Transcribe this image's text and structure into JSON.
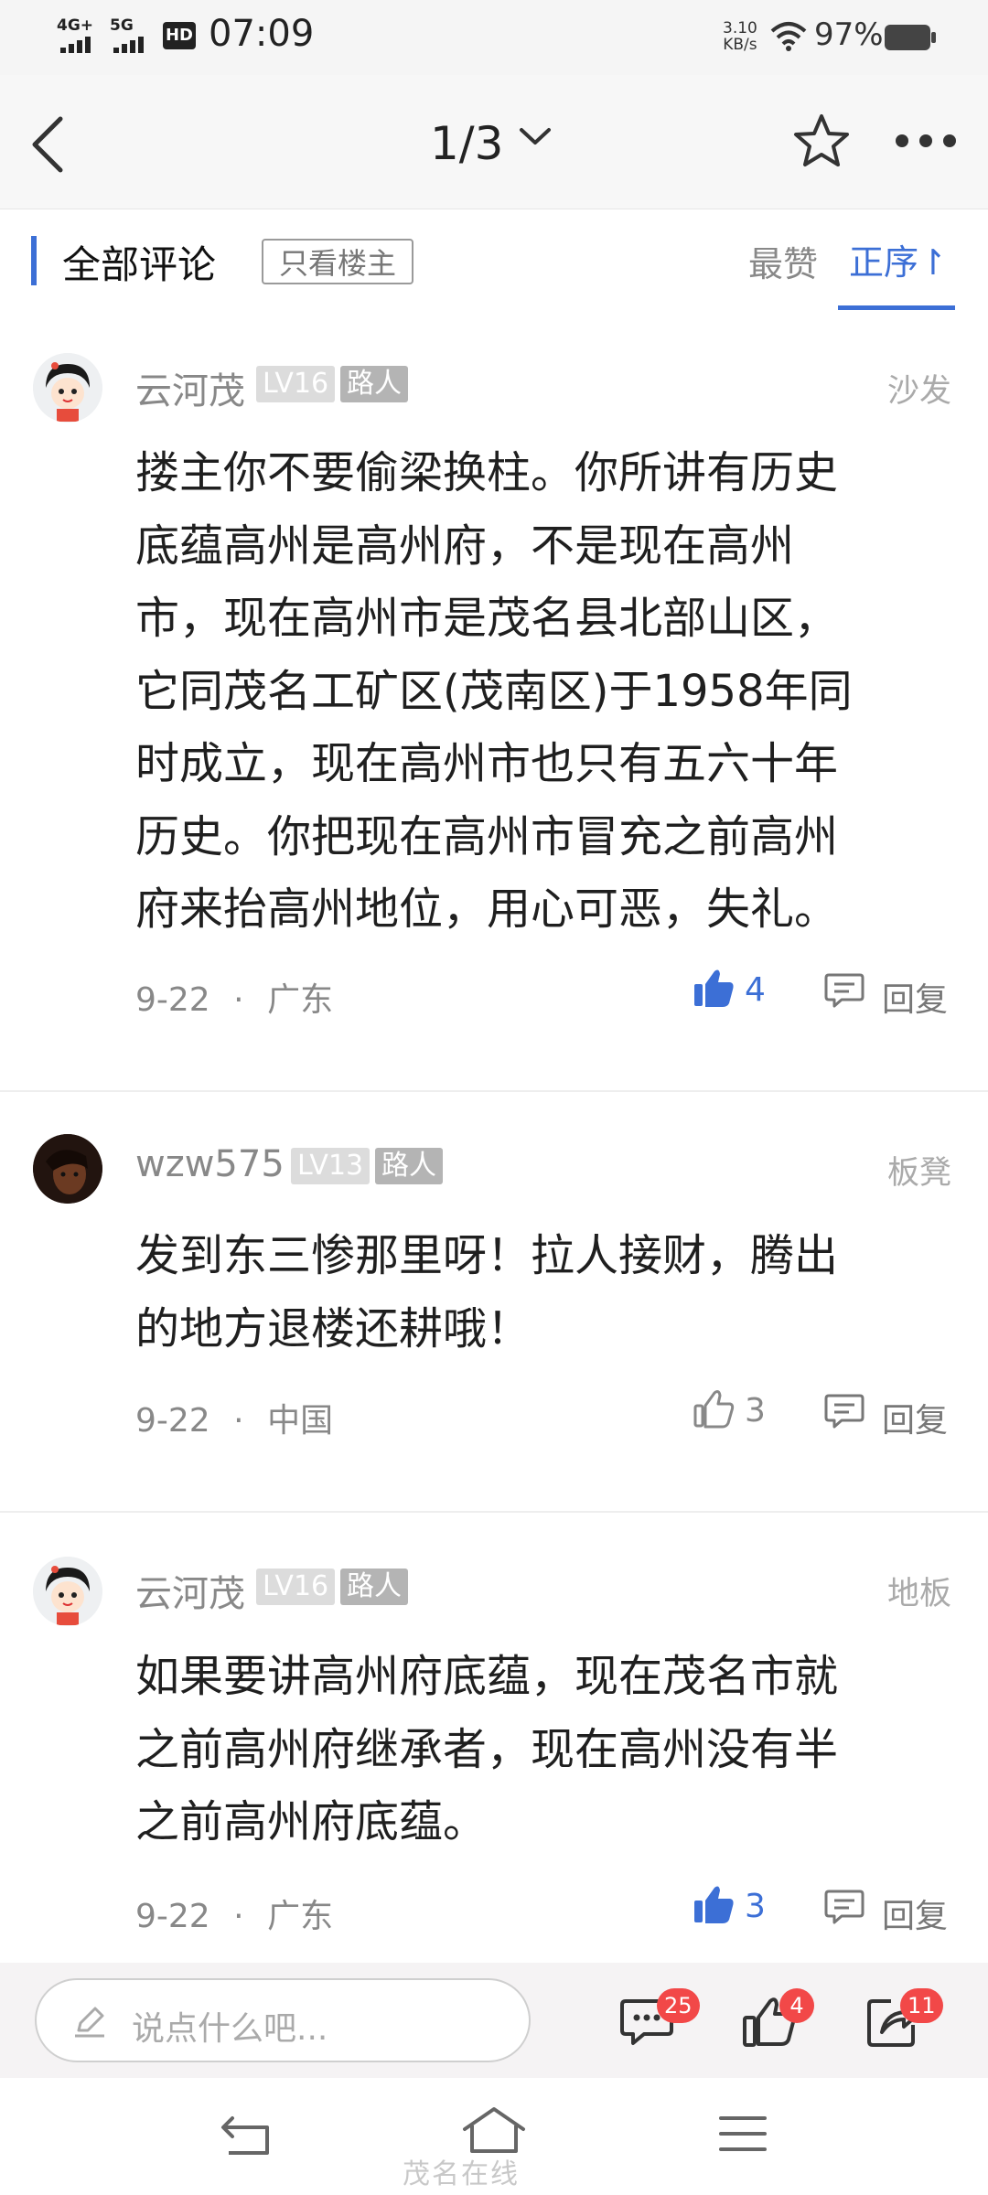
{
  "status_bar": {
    "net1": "4G+",
    "net2": "5G",
    "hd": "HD",
    "time": "07:09",
    "speed_value": "3.10",
    "speed_unit": "KB/s",
    "battery": "97%"
  },
  "navbar": {
    "page_indicator": "1/3",
    "icons": [
      "back-icon",
      "chevron-down-icon",
      "star-icon",
      "more-icon"
    ]
  },
  "filter_bar": {
    "title": "全部评论",
    "only_op": "只看楼主",
    "sort_hot": "最赞",
    "sort_asc": "正序↾",
    "accent_color": "#3c6fd6"
  },
  "comments": [
    {
      "username": "云河茂",
      "level": "LV16",
      "role": "路人",
      "floor": "沙发",
      "lines": [
        "搂主你不要偷梁换柱。你所讲有历史",
        "底蕴高州是高州府，不是现在高州",
        "市，现在高州市是茂名县北部山区，",
        "它同茂名工矿区(茂南区)于1958年同",
        "时成立，现在高州市也只有五六十年",
        "历史。你把现在高州市冒充之前高州",
        "府来抬高州地位，用心可恶，失礼。"
      ],
      "date": "9-22",
      "region": "广东",
      "likes": "4",
      "liked": true,
      "reply": "回复"
    },
    {
      "username": "wzw575",
      "level": "LV13",
      "role": "路人",
      "floor": "板凳",
      "lines": [
        "发到东三惨那里呀！拉人接财，腾出",
        "的地方退楼还耕哦！"
      ],
      "date": "9-22",
      "region": "中国",
      "likes": "3",
      "liked": false,
      "reply": "回复"
    },
    {
      "username": "云河茂",
      "level": "LV16",
      "role": "路人",
      "floor": "地板",
      "lines": [
        "如果要讲高州府底蕴，现在茂名市就",
        "之前高州府继承者，现在高州没有半",
        "之前高州府底蕴。"
      ],
      "date": "9-22",
      "region": "广东",
      "likes": "3",
      "liked": true,
      "reply": "回复"
    }
  ],
  "separator": "·",
  "bottom_bar": {
    "input_placeholder": "说点什么吧...",
    "comment_count": "25",
    "like_count": "4",
    "share_count": "11"
  },
  "watermark": "茂名在线"
}
